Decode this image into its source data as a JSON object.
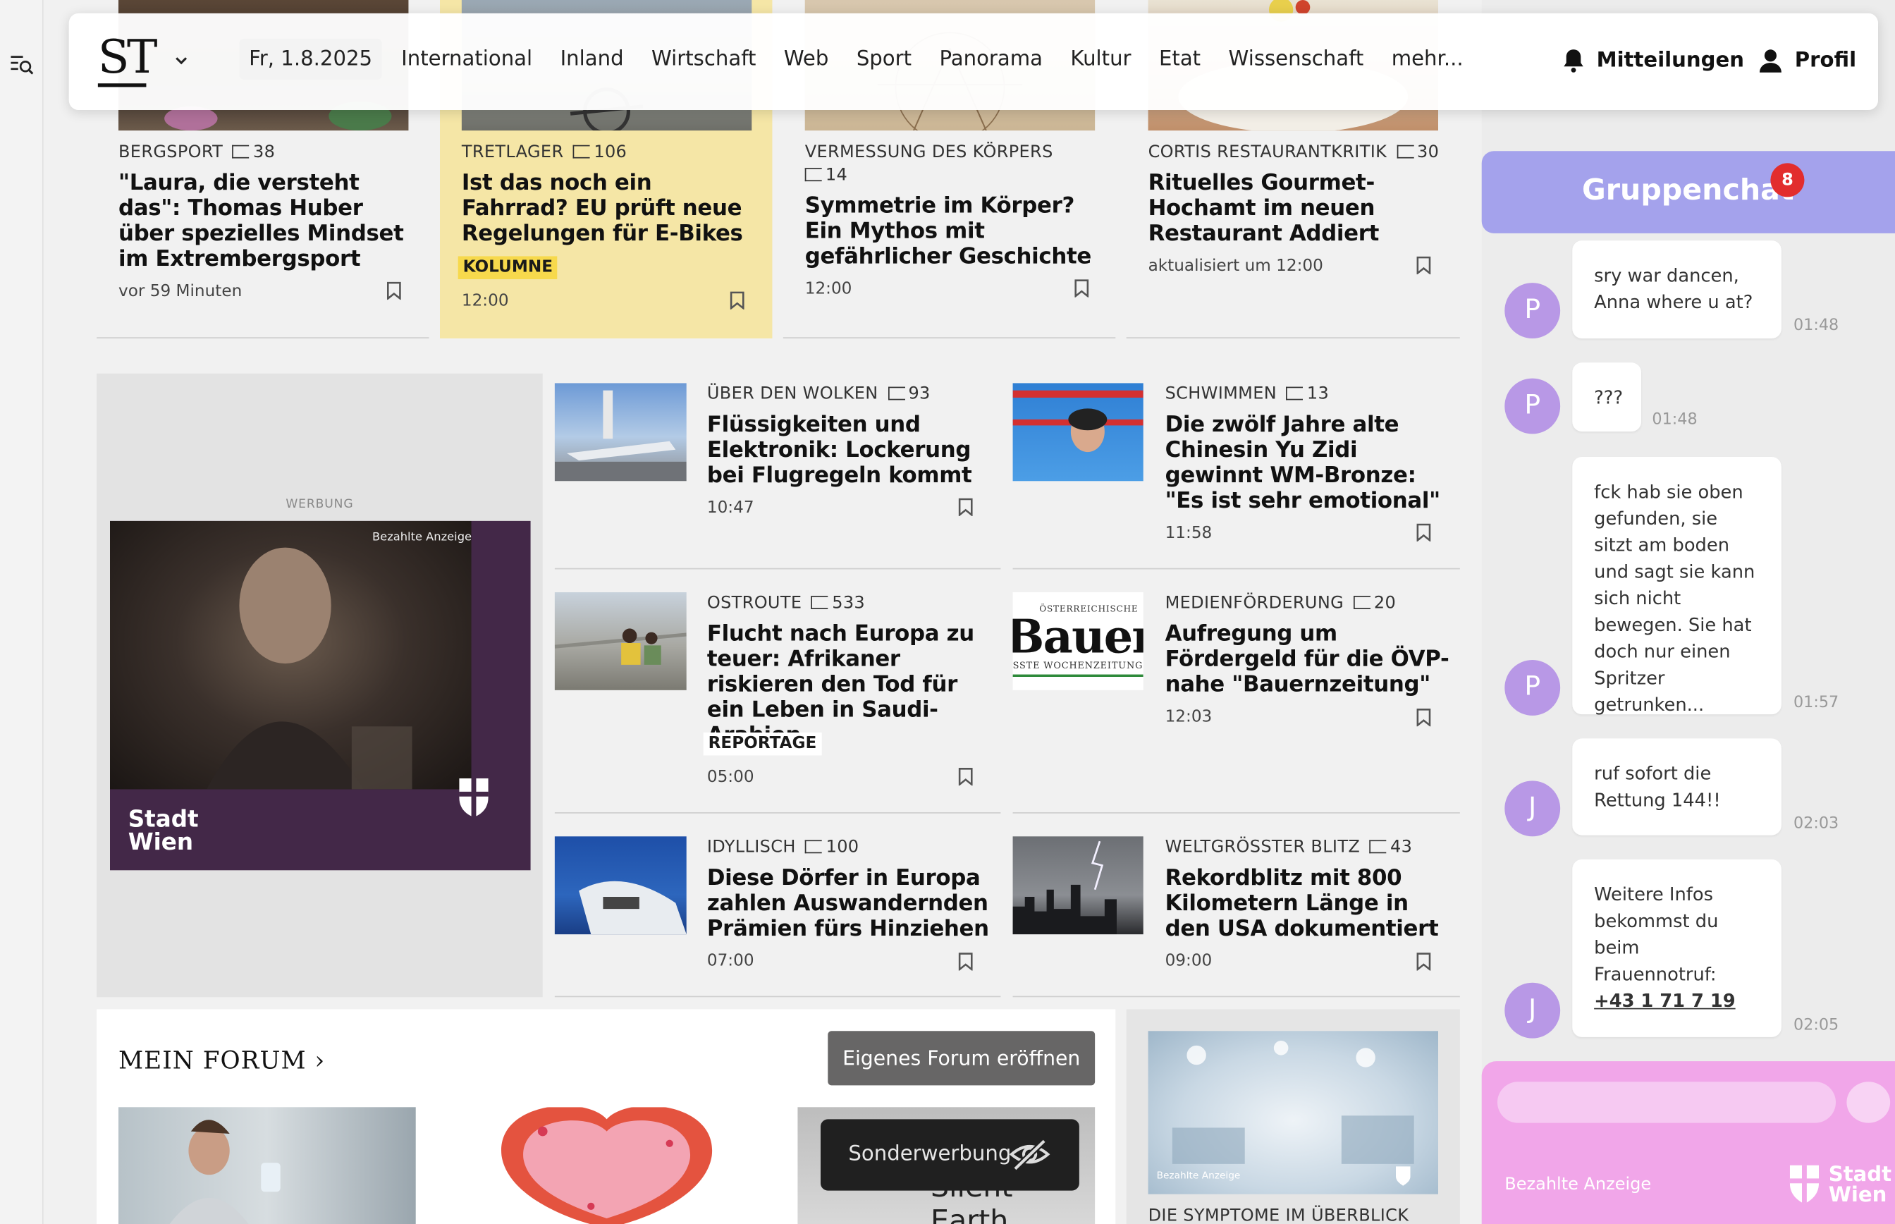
{
  "header": {
    "logo": "ST",
    "date": "Fr, 1.8.2025",
    "nav": [
      "International",
      "Inland",
      "Wirtschaft",
      "Web",
      "Sport",
      "Panorama",
      "Kultur",
      "Etat",
      "Wissenschaft",
      "mehr..."
    ],
    "notifications_label": "Mitteilungen",
    "profile_label": "Profil"
  },
  "top_articles": [
    {
      "topic": "BERGSPORT",
      "comments": "38",
      "headline": "\"Laura, die versteht das\": Thomas Huber über spezielles Mindset im Ex­trembergsport",
      "time": "vor 59 Minuten"
    },
    {
      "topic": "TRETLAGER",
      "comments": "106",
      "headline": "Ist das noch ein Fahrrad? EU prüft neue Regelungen für E-Bikes",
      "kicker": "KOLUMNE",
      "time": "12:00"
    },
    {
      "topic": "VERMESSUNG DES KÖRPERS",
      "comments": "14",
      "headline": "Symmetrie im Körper? Ein Mythos mit gefährlicher Geschichte",
      "time": "12:00"
    },
    {
      "topic": "CORTIS RESTAURANTKRITIK",
      "comments": "30",
      "headline": "Rituelles Gourmet-Hoch­amt im neuen Restaurant Addiert",
      "time": "aktualisiert um 12:00"
    }
  ],
  "ad": {
    "label": "WERBUNG",
    "paid": "Bezahlte Anzeige",
    "brand": "Stadt\nWien"
  },
  "grid_articles": [
    {
      "topic": "ÜBER DEN WOLKEN",
      "comments": "93",
      "headline": "Flüssigkeiten und Elektronik: Lockerung bei Flugregeln kommt",
      "time": "10:47"
    },
    {
      "topic": "SCHWIMMEN",
      "comments": "13",
      "headline": "Die zwölf Jahre alte Chinesin Yu Zidi gewinnt WM-Bronze: \"Es ist sehr emotional\"",
      "time": "11:58"
    },
    {
      "topic": "OSTROUTE",
      "comments": "533",
      "headline": "Flucht nach Europa zu teuer: Afrikaner riskieren den Tod für ein Leben in Saudi-Arabien",
      "kicker": "REPORTAGE",
      "time": "05:00"
    },
    {
      "topic": "MEDIENFÖRDERUNG",
      "comments": "20",
      "headline": "Aufregung um Fördergeld für die ÖVP-nahe \"Bauernzeitung\"",
      "time": "12:03",
      "thumb_text": "Bauer",
      "thumb_small": "ÖSTERREICHISCHE",
      "thumb_small2": "SSTE WOCHENZEITUNG"
    },
    {
      "topic": "IDYLLISCH",
      "comments": "100",
      "headline": "Diese Dörfer in Europa zahlen Auswandernden Prämien fürs Hinziehen",
      "time": "07:00"
    },
    {
      "topic": "WELTGRÖSSTER BLITZ",
      "comments": "43",
      "headline": "Rekordblitz mit 800 Kilometern Länge in den USA dokumentiert",
      "time": "09:00"
    }
  ],
  "forum": {
    "title": "MEIN FORUM ›",
    "button": "Eigenes Forum eröffnen",
    "sonder": "Sonderwerbung",
    "card3_text": "Silent Earth"
  },
  "side_ad": {
    "paid": "Bezahlte Anzeige",
    "teaser": "DIE SYMPTOME IM ÜBERBLICK"
  },
  "chat": {
    "title": "Gruppenchat",
    "badge": "8",
    "messages": [
      {
        "avatar": "P",
        "text": "sry war dancen, Anna where u at?",
        "time": "01:48"
      },
      {
        "avatar": "P",
        "text": "???",
        "time": "01:48"
      },
      {
        "avatar": "P",
        "text": "fck hab sie oben gefunden, sie sitzt am boden und sagt sie kann sich nicht bewegen. Sie hat doch nur einen Spritzer getrunken...",
        "time": "01:57"
      },
      {
        "avatar": "J",
        "text": "ruf sofort die Rettung 144!!",
        "time": "02:03"
      },
      {
        "avatar": "J",
        "text": "Weitere Infos bekommst du beim Frauennotruf:",
        "link": "+43 1 71 7 19",
        "time": "02:05"
      }
    ],
    "ad_paid": "Bezahlte Anzeige",
    "ad_brand": "Stadt\nWien"
  },
  "colors": {
    "accent_chat": "#a4a2ec",
    "kolumne_bg": "#f5e6a6",
    "kicker_yellow": "#f7d94c",
    "badge_red": "#e22d2d",
    "chat_avatar": "#b898e6",
    "chat_input_bg": "#f1a6e9"
  }
}
